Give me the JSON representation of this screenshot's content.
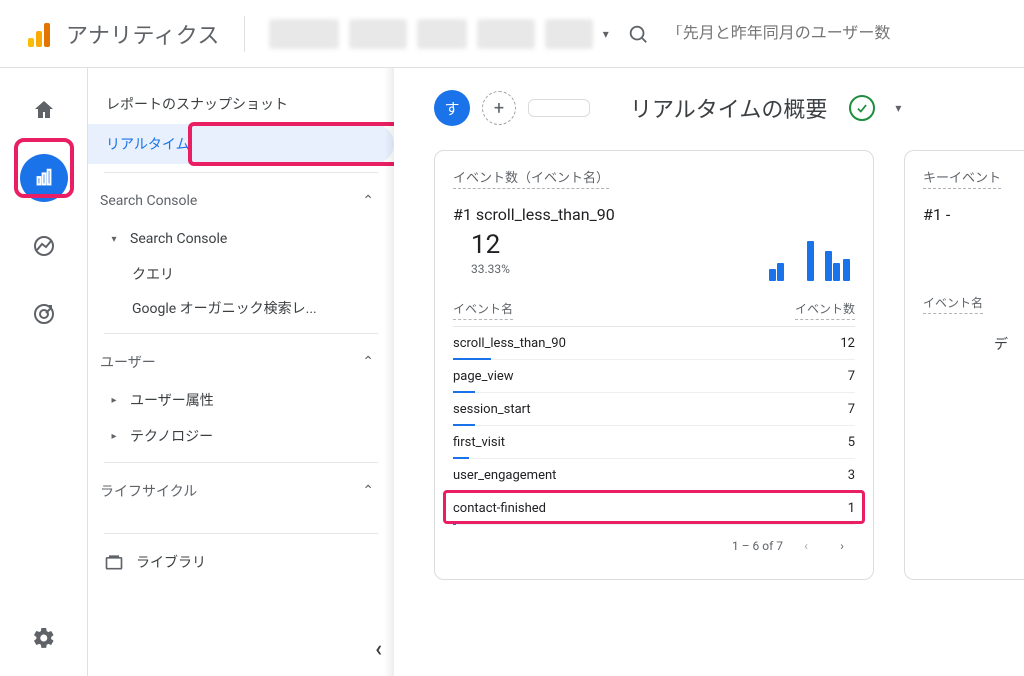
{
  "header": {
    "app_title": "アナリティクス",
    "search_placeholder": "「先月と昨年同月のユーザー数"
  },
  "sidebar": {
    "snapshot": "レポートのスナップショット",
    "realtime": "リアルタイム",
    "search_console_sec": "Search Console",
    "search_console_group": "Search Console",
    "queries": "クエリ",
    "organic": "Google オーガニック検索レ...",
    "user_sec": "ユーザー",
    "user_attributes": "ユーザー属性",
    "technology": "テクノロジー",
    "lifecycle_sec": "ライフサイクル",
    "library": "ライブラリ"
  },
  "page": {
    "chip_su": "す",
    "title": "リアルタイムの概要"
  },
  "card_events": {
    "header": "イベント数（イベント名）",
    "top_label": "#1 scroll_less_than_90",
    "top_value": "12",
    "top_pct": "33.33%",
    "col_event": "イベント名",
    "col_count": "イベント数",
    "rows": [
      {
        "name": "scroll_less_than_90",
        "count": "12",
        "bar": 100
      },
      {
        "name": "page_view",
        "count": "7",
        "bar": 58
      },
      {
        "name": "session_start",
        "count": "7",
        "bar": 58
      },
      {
        "name": "first_visit",
        "count": "5",
        "bar": 42
      },
      {
        "name": "user_engagement",
        "count": "3",
        "bar": 25
      },
      {
        "name": "contact-finished",
        "count": "1",
        "bar": 9
      }
    ],
    "pager": "1 – 6 of 7",
    "highlight_index": 5
  },
  "card_key": {
    "header": "キーイベント",
    "top_label": "#1  -",
    "col_event": "イベント名",
    "cutoff": "デ"
  },
  "chart_data": {
    "type": "bar",
    "title": "イベント数（イベント名）",
    "xlabel": "イベント名",
    "ylabel": "イベント数",
    "ylim": [
      0,
      12
    ],
    "categories": [
      "scroll_less_than_90",
      "page_view",
      "session_start",
      "first_visit",
      "user_engagement",
      "contact-finished"
    ],
    "values": [
      12,
      7,
      7,
      5,
      3,
      1
    ]
  }
}
